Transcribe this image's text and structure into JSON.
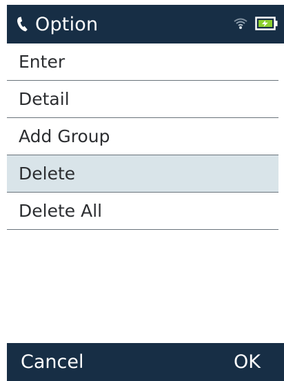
{
  "header": {
    "title": "Option",
    "phone_icon": "phone-handset-icon",
    "wifi_icon": "wifi-icon",
    "battery_icon": "battery-charging-icon"
  },
  "menu": {
    "items": [
      {
        "label": "Enter",
        "selected": false
      },
      {
        "label": "Detail",
        "selected": false
      },
      {
        "label": "Add Group",
        "selected": false
      },
      {
        "label": "Delete",
        "selected": true
      },
      {
        "label": "Delete All",
        "selected": false
      }
    ]
  },
  "softkeys": {
    "left": "Cancel",
    "right": "OK"
  },
  "colors": {
    "bar_background": "#172e45",
    "selected_row": "#d9e4e9",
    "divider": "#68727a",
    "battery_fill": "#8ccf2e"
  }
}
